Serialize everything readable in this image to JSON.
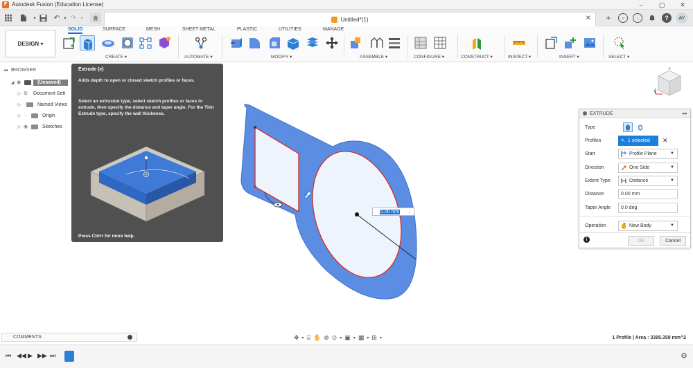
{
  "window": {
    "title": "Autodesk Fusion (Education License)"
  },
  "tab": {
    "title": "Untitled*(1)",
    "avatar": "AY"
  },
  "ribbon": {
    "workspace": "DESIGN",
    "tabs": [
      "SOLID",
      "SURFACE",
      "MESH",
      "SHEET METAL",
      "PLASTIC",
      "UTILITIES",
      "MANAGE"
    ],
    "groups": [
      "CREATE",
      "AUTOMATE",
      "MODIFY",
      "ASSEMBLE",
      "CONFIGURE",
      "CONSTRUCT",
      "INSPECT",
      "INSERT",
      "SELECT"
    ]
  },
  "browser": {
    "title": "BROWSER",
    "root": "(Unsaved)",
    "items": [
      "Document Sett",
      "Named Views",
      "Origin",
      "Sketches"
    ]
  },
  "tooltip": {
    "title": "Extrude (e)",
    "summary": "Adds depth to open or closed sketch profiles or faces.",
    "description": "Select an extrusion type, select sketch profiles or faces to extrude, then specify the distance and taper angle. For the Thin Extrude type, specify the wall thickness.",
    "footer": "Press Ctrl+/ for more help."
  },
  "extrude": {
    "title": "EXTRUDE",
    "rows": {
      "type": "Type",
      "profiles": "Profiles",
      "profiles_value": "1 selected",
      "start": "Start",
      "start_value": "Profile Plane",
      "direction": "Direction",
      "direction_value": "One Side",
      "extent_type": "Extent Type",
      "extent_value": "Distance",
      "distance": "Distance",
      "distance_value": "0.00 mm",
      "taper": "Taper Angle",
      "taper_value": "0.0 deg",
      "operation": "Operation",
      "operation_value": "New Body"
    },
    "ok": "OK",
    "cancel": "Cancel"
  },
  "canvas": {
    "distance_input": "0.00 mm"
  },
  "comments": {
    "label": "COMMENTS"
  },
  "status": {
    "text": "1 Profile | Area : 3395.359 mm^2"
  },
  "colors": {
    "accent": "#1d7fd9",
    "body_blue": "#5b8ee3",
    "profile_red": "#d42a2a"
  }
}
